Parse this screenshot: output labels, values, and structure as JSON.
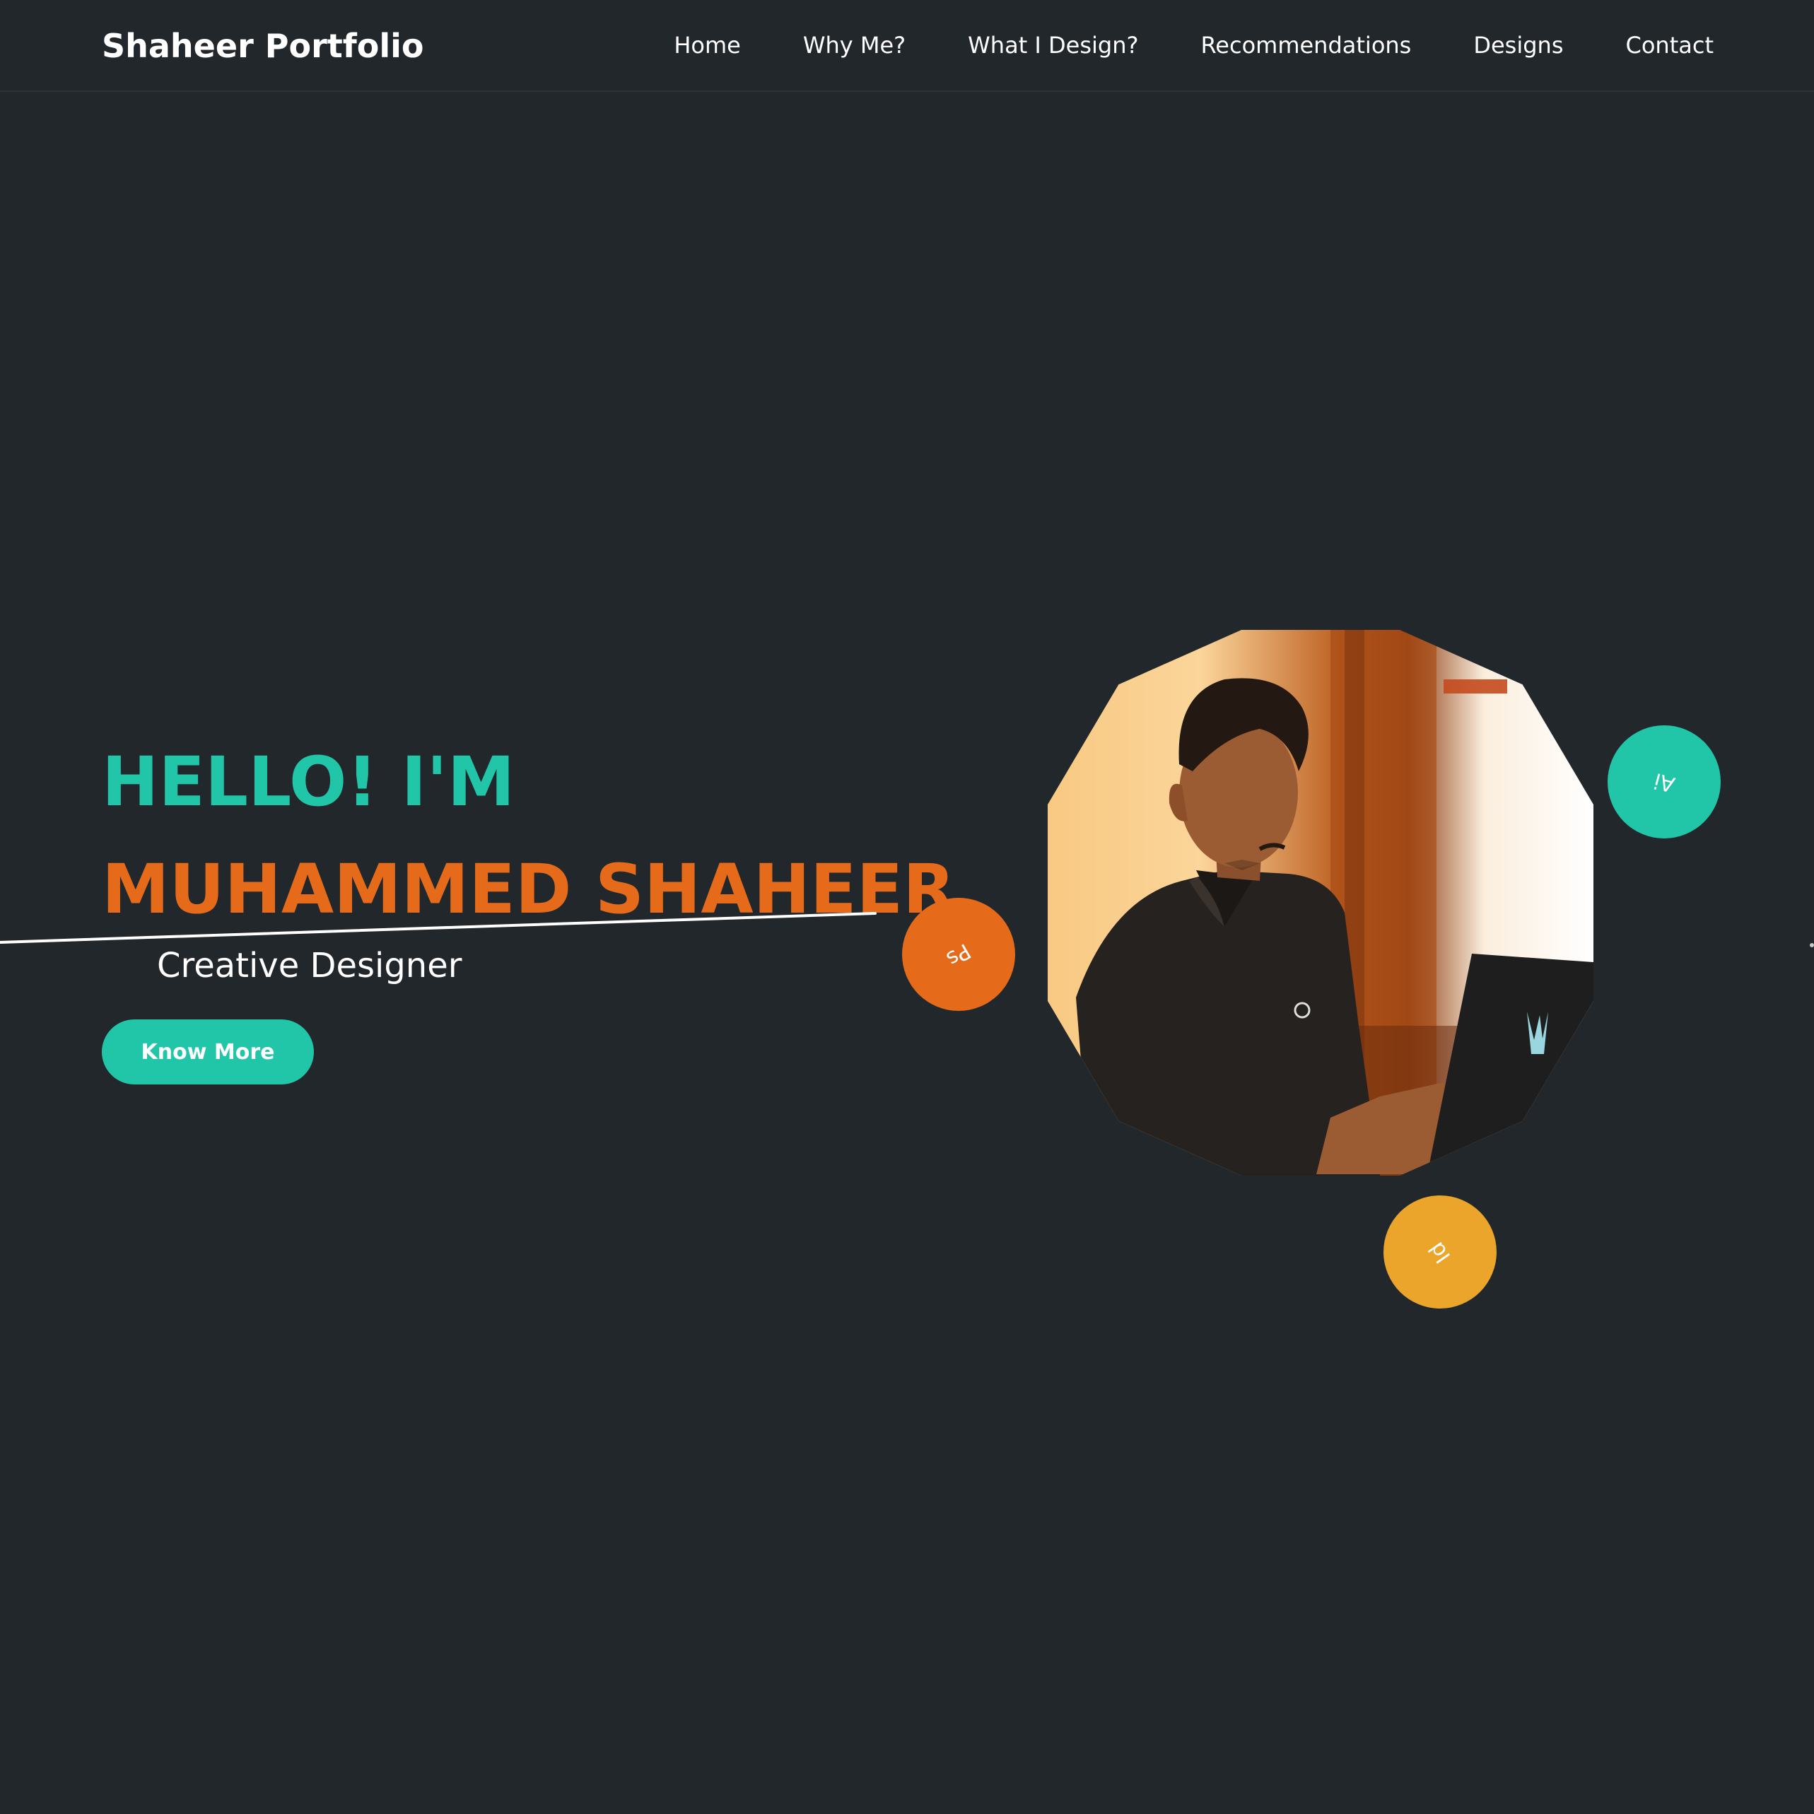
{
  "header": {
    "brand": "Shaheer Portfolio",
    "nav": [
      {
        "label": "Home"
      },
      {
        "label": "Why Me?"
      },
      {
        "label": "What I Design?"
      },
      {
        "label": "Recommendations"
      },
      {
        "label": "Designs"
      },
      {
        "label": "Contact"
      }
    ]
  },
  "hero": {
    "greeting": "HELLO! I'M",
    "name": "MUHAMMED SHAHEER",
    "role": "Creative Designer",
    "cta_label": "Know More"
  },
  "badges": {
    "ps": "Ps",
    "ai": "Ai",
    "id": "Id"
  },
  "colors": {
    "background": "#22272c",
    "teal": "#21c5a7",
    "orange": "#e56b1b",
    "gold": "#eaa52a",
    "text": "#ffffff"
  },
  "icons": {
    "swoosh": "hand-drawn-underline",
    "portrait": "profile-photo"
  }
}
